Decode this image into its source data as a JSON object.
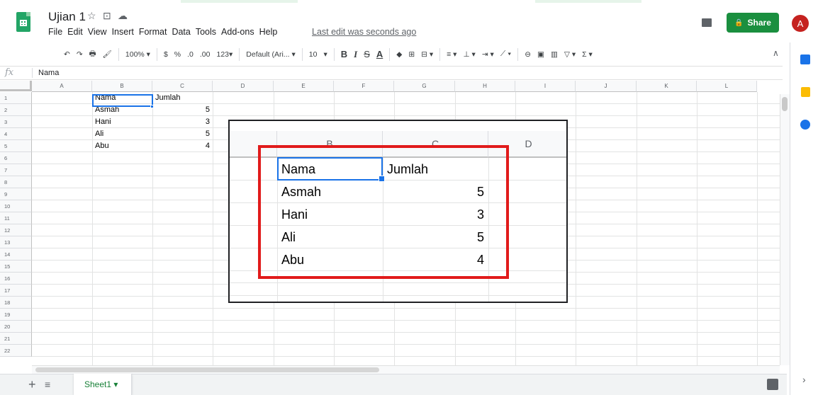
{
  "doc": {
    "title": "Ujian 1",
    "last_edit": "Last edit was seconds ago"
  },
  "icons": {
    "star": "☆",
    "move": "⊡",
    "cloud": "☁"
  },
  "menu": [
    "File",
    "Edit",
    "View",
    "Insert",
    "Format",
    "Data",
    "Tools",
    "Add-ons",
    "Help"
  ],
  "share": {
    "label": "Share",
    "lock": "🔒"
  },
  "avatar": {
    "initial": "A"
  },
  "toolbar": {
    "undo": "↶",
    "redo": "↷",
    "print": "🖶",
    "paint": "🖌",
    "zoom": "100% ▾",
    "currency": "$",
    "percent": "%",
    "dec_less": ".0",
    "dec_more": ".00",
    "more_formats": "123▾",
    "font": "Default (Ari... ▾",
    "font_size": "10",
    "size_drop": "▾",
    "bold": "B",
    "italic": "I",
    "strike": "S",
    "underline": "A",
    "fill": "◆",
    "borders": "⊞",
    "merge": "⊟ ▾",
    "halign": "≡ ▾",
    "valign": "⊥ ▾",
    "wrap": "⇥ ▾",
    "rotate": "⟋ ▾",
    "link": "⊖",
    "comment": "▣",
    "chart": "▥",
    "filter": "▽ ▾",
    "functions": "Σ ▾",
    "collapse": "∧"
  },
  "formula": {
    "fx": "fx",
    "value": "Nama"
  },
  "columns": [
    "A",
    "B",
    "C",
    "D",
    "E",
    "F",
    "G",
    "H",
    "I",
    "J",
    "K",
    "L"
  ],
  "rows": [
    "1",
    "2",
    "3",
    "4",
    "5",
    "6",
    "7",
    "8",
    "9",
    "10",
    "11",
    "12",
    "13",
    "14",
    "15",
    "16",
    "17",
    "18",
    "19",
    "20",
    "21",
    "22"
  ],
  "cells": {
    "B1": "Nama",
    "C1": "Jumlah",
    "B2": "Asmah",
    "C2": "5",
    "B3": "Hani",
    "C3": "3",
    "B4": "Ali",
    "C4": "5",
    "B5": "Abu",
    "C5": "4"
  },
  "zoom_inset": {
    "col_headers": [
      "B",
      "C",
      "D"
    ],
    "rows": [
      {
        "name": "Nama",
        "value": "Jumlah"
      },
      {
        "name": "Asmah",
        "value": "5"
      },
      {
        "name": "Hani",
        "value": "3"
      },
      {
        "name": "Ali",
        "value": "5"
      },
      {
        "name": "Abu",
        "value": "4"
      }
    ]
  },
  "sheet": {
    "add": "+",
    "all": "≡",
    "tab": "Sheet1 ▾"
  },
  "side": {
    "expand": "›"
  },
  "colors": {
    "accent": "#1a73e8",
    "share": "#1a8f3f",
    "highlight": "#e11b1b",
    "avatar": "#c5221f"
  }
}
